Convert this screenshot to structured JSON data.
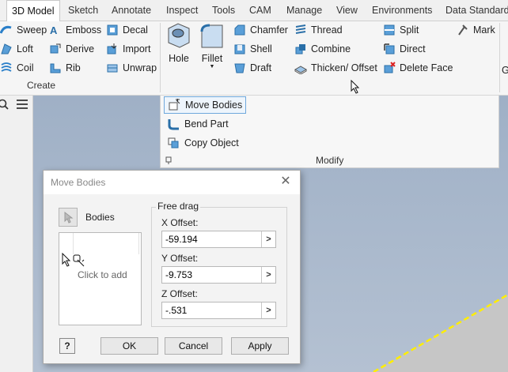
{
  "tabs": [
    "3D Model",
    "Sketch",
    "Annotate",
    "Inspect",
    "Tools",
    "CAM",
    "Manage",
    "View",
    "Environments",
    "Data Standard"
  ],
  "ribbon": {
    "create": {
      "title": "Create",
      "col1": [
        "Sweep",
        "Loft",
        "Coil"
      ],
      "col2": [
        "Emboss",
        "Derive",
        "Rib"
      ],
      "col3": [
        "Decal",
        "Import",
        "Unwrap"
      ]
    },
    "modify": {
      "title": "Modify",
      "hole": "Hole",
      "fillet": "Fillet",
      "col1": [
        "Chamfer",
        "Shell",
        "Draft"
      ],
      "col2": [
        "Thread",
        "Combine",
        "Thicken/ Offset"
      ],
      "col3": [
        "Split",
        "Direct",
        "Delete Face"
      ],
      "mark": "Mark"
    },
    "overflow_letter": "G",
    "flyout": [
      "Move Bodies",
      "Bend Part",
      "Copy Object"
    ]
  },
  "dialog": {
    "title": "Move Bodies",
    "bodies_label": "Bodies",
    "click_to_add": "Click to add",
    "group_title": "Free drag",
    "x_label": "X Offset:",
    "x_value": "-59.194",
    "y_label": "Y Offset:",
    "y_value": "-9.753",
    "z_label": "Z Offset:",
    "z_value": "-.531",
    "help": "?",
    "ok": "OK",
    "cancel": "Cancel",
    "apply": "Apply",
    "arrow": ">"
  },
  "colors": {
    "accent": "#0f6cbd",
    "viewport_top": "#9fb0c6",
    "edge_yellow": "#ffee00",
    "highlight": "#6fa8dc"
  }
}
